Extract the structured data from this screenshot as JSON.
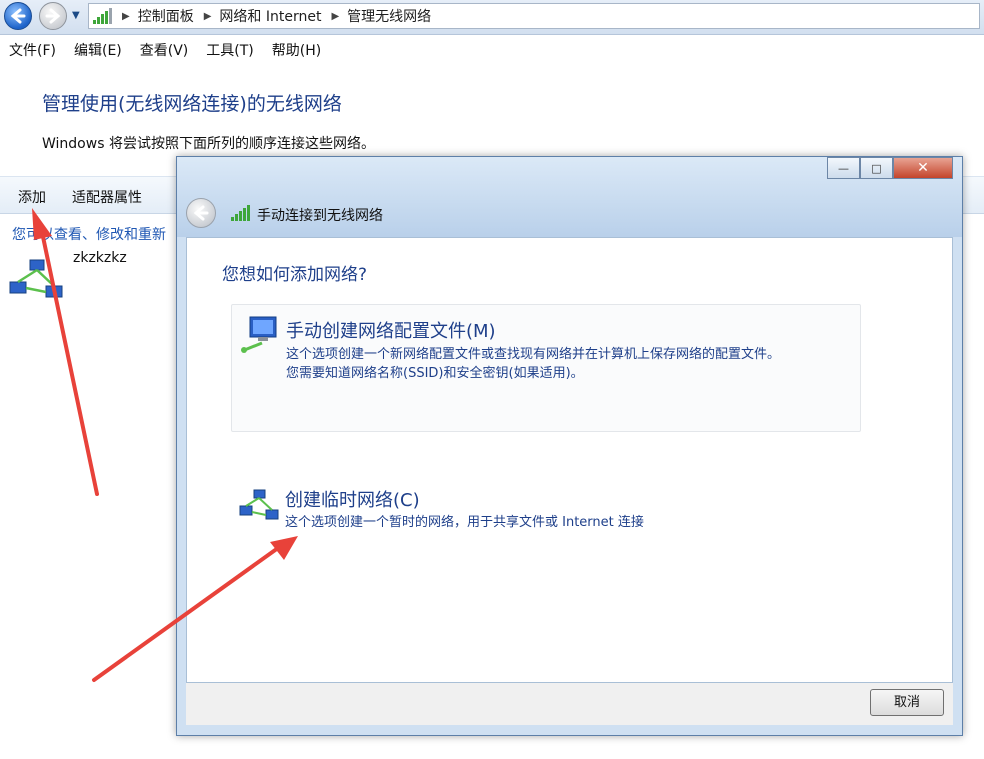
{
  "breadcrumb": [
    "控制面板",
    "网络和 Internet",
    "管理无线网络"
  ],
  "menu": [
    "文件(F)",
    "编辑(E)",
    "查看(V)",
    "工具(T)",
    "帮助(H)"
  ],
  "page": {
    "title": "管理使用(无线网络连接)的无线网络",
    "description": "Windows 将尝试按照下面所列的顺序连接这些网络。"
  },
  "toolbar": {
    "add": "添加",
    "adapter": "适配器属性"
  },
  "hint": "您可以查看、修改和重新",
  "network_item": {
    "name": "zkzkzkz",
    "icon": "network-icon"
  },
  "dialog": {
    "title": "手动连接到无线网络",
    "window_buttons": {
      "minimize": "—",
      "maximize": "□",
      "close": "✕"
    },
    "question": "您想如何添加网络?",
    "options": [
      {
        "title": "手动创建网络配置文件(M)",
        "desc1": "这个选项创建一个新网络配置文件或查找现有网络并在计算机上保存网络的配置文件。",
        "desc2": "您需要知道网络名称(SSID)和安全密钥(如果适用)。",
        "icon": "computer-network-icon"
      },
      {
        "title": "创建临时网络(C)",
        "desc1": "这个选项创建一个暂时的网络，用于共享文件或 Internet 连接",
        "icon": "ad-hoc-network-icon"
      }
    ],
    "cancel": "取消"
  },
  "colors": {
    "title_blue": "#1e3f8a",
    "link_blue": "#1f57b3",
    "arrow_red": "#e8423a"
  }
}
